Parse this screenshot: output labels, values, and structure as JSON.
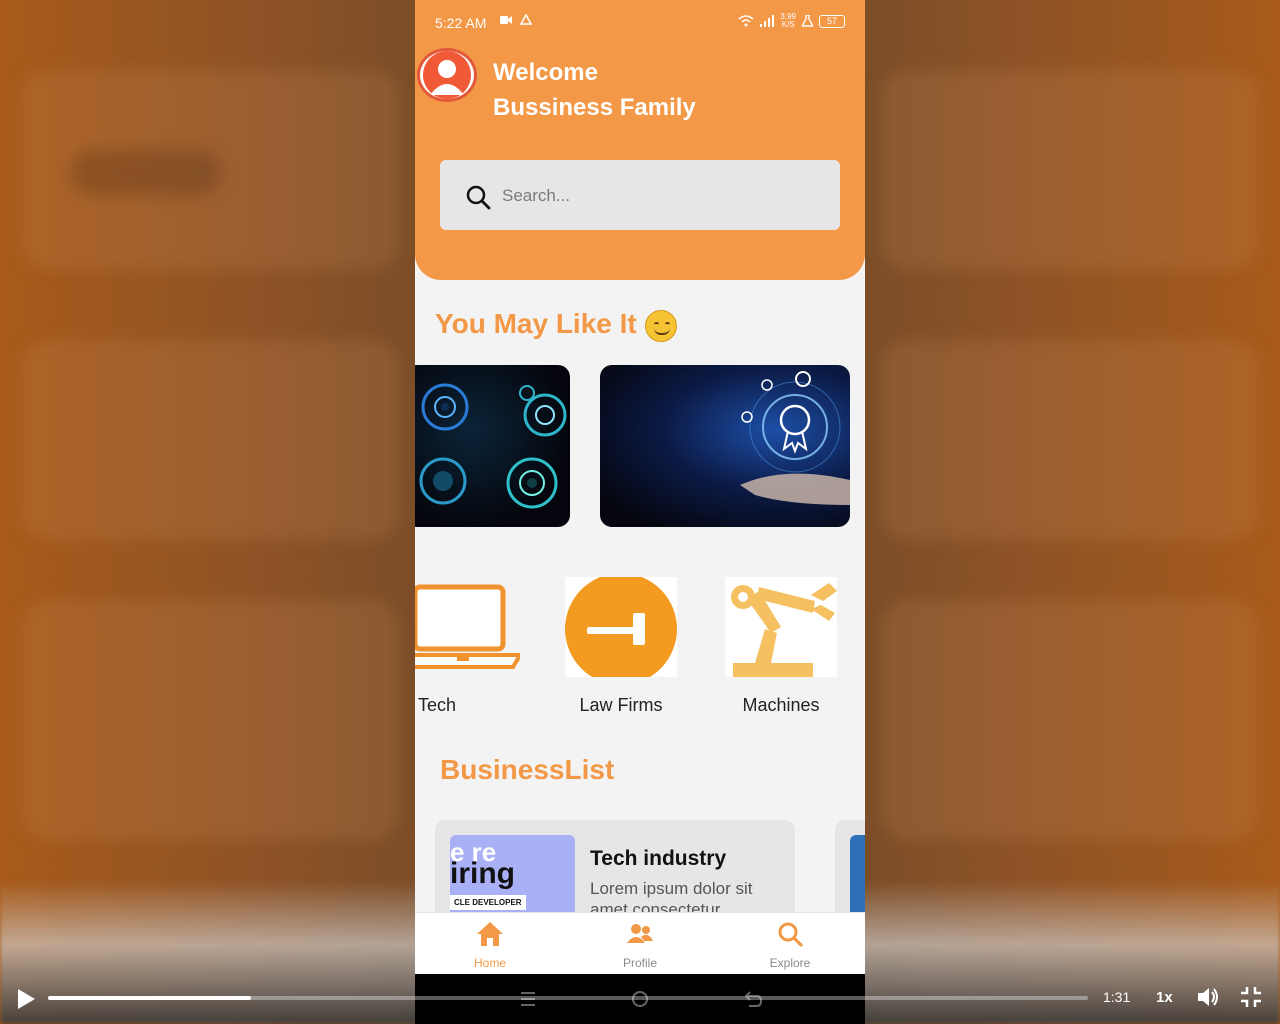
{
  "statusbar": {
    "time": "5:22 AM",
    "speed_top": "3.99",
    "speed_unit": "K/S",
    "battery": "57"
  },
  "header": {
    "welcome": "Welcome",
    "subtitle": "Bussiness Family"
  },
  "search": {
    "placeholder": "Search..."
  },
  "sections": {
    "recommended_title": "You May Like It",
    "business_title": "BusinessList"
  },
  "categories": [
    {
      "label": "Tech",
      "icon": "laptop-icon"
    },
    {
      "label": "Law Firms",
      "icon": "gavel-icon"
    },
    {
      "label": "Machines",
      "icon": "robot-arm-icon"
    }
  ],
  "business_card": {
    "title": "Tech industry",
    "description": "Lorem ipsum dolor sit amet consectetur",
    "image_text_1": "e re",
    "image_text_2": "iring",
    "image_text_3": "CLE DEVELOPER"
  },
  "tabs": [
    {
      "label": "Home",
      "icon": "home-icon",
      "active": true
    },
    {
      "label": "Profile",
      "icon": "people-icon",
      "active": false
    },
    {
      "label": "Explore",
      "icon": "search-icon",
      "active": false
    }
  ],
  "video": {
    "time": "1:31",
    "speed": "1x",
    "progress": 0.195
  },
  "colors": {
    "accent": "#f39846",
    "header_bg": "#f39846",
    "card_bg": "#e6e6e9"
  }
}
